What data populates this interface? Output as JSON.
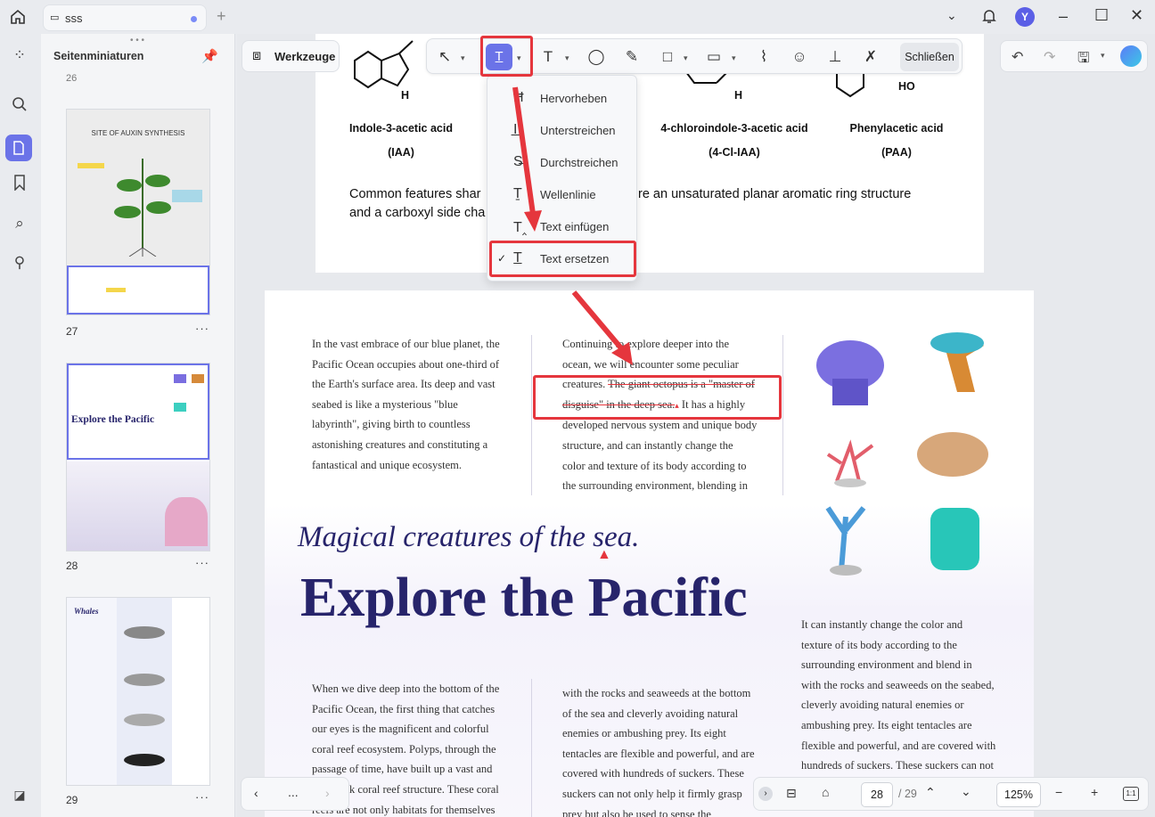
{
  "window": {
    "tab_title": "sss",
    "avatar_letter": "Y"
  },
  "sidebar": {
    "title": "Seitenminiaturen",
    "pages": [
      {
        "number": "27",
        "thumb_title": "SITE OF AUXIN SYNTHESIS"
      },
      {
        "number": "28",
        "thumb_title": "Explore the Pacific"
      },
      {
        "number": "29",
        "thumb_title": "Whales"
      }
    ]
  },
  "toolbar": {
    "tools_label": "Werkzeuge",
    "close_label": "Schließen"
  },
  "dropdown": {
    "items": [
      {
        "label": "Hervorheben",
        "icon": "highlight-icon"
      },
      {
        "label": "Unterstreichen",
        "icon": "underline-icon"
      },
      {
        "label": "Durchstreichen",
        "icon": "strikethrough-icon"
      },
      {
        "label": "Wellenlinie",
        "icon": "squiggly-icon"
      },
      {
        "label": "Text einfügen",
        "icon": "insert-text-icon"
      },
      {
        "label": "Text ersetzen",
        "icon": "replace-text-icon",
        "checked": true
      }
    ]
  },
  "page27": {
    "compounds": [
      {
        "name": "Indole-3-acetic acid",
        "abbr": "(IAA)"
      },
      {
        "name": "4-chloroindole-3-acetic acid",
        "abbr": "(4-Cl-IAA)"
      },
      {
        "name": "Phenylacetic acid",
        "abbr": "(PAA)"
      }
    ],
    "atom_labels": [
      "H",
      "H",
      "HO"
    ],
    "features_line1_left": "Common features shar",
    "features_line1_right": "re an unsaturated planar aromatic ring structure",
    "features_line2": "and a carboxyl side cha"
  },
  "page28": {
    "col1_top": [
      "In the vast embrace of our blue planet, the",
      "Pacific Ocean occupies about one-third of",
      "the Earth's surface area. Its deep and vast",
      "seabed is like a mysterious \"blue",
      "labyrinth\", giving birth to countless",
      "astonishing creatures and constituting a",
      "fantastical and unique ecosystem."
    ],
    "col2_top": [
      "Continuing to explore deeper into the",
      "ocean, we will encounter some peculiar"
    ],
    "col2_line3_plain": "creatures.",
    "col2_line3_struck": "The giant octopus is a \"master of",
    "col2_line4_struck": "disguise\" in the deep sea.",
    "col2_line4_plain": "It has a highly",
    "col2_rest": [
      "developed nervous system and unique body",
      "structure, and can instantly change the",
      "color and texture of its body according to",
      "the surrounding environment, blending in"
    ],
    "subtitle": "Magical creatures of the sea.",
    "headline": "Explore the Pacific",
    "col1_bottom": [
      "When we dive deep into the bottom of the",
      "Pacific Ocean, the first thing that catches",
      "our eyes is the magnificent and colorful",
      "coral reef ecosystem. Polyps, through the",
      "passage of time, have built up a vast and",
      "k coral reef structure. These coral",
      "reefs are not only habitats for themselves"
    ],
    "col2_bottom": [
      "with the rocks and seaweeds at the bottom",
      "of the sea and cleverly avoiding natural",
      "enemies or ambushing prey. Its eight",
      "tentacles are flexible and powerful, and are",
      "covered with hundreds of suckers. These",
      "suckers can not only help it firmly grasp",
      "prey but also be used to sense the"
    ],
    "col3_bottom": [
      "It can instantly change the color and",
      "texture of its body according to the",
      "surrounding environment and blend in",
      "with the rocks and seaweeds on the seabed,",
      "cleverly avoiding natural enemies or",
      "ambushing prey. Its eight tentacles are",
      "flexible and powerful, and are covered with",
      "hundreds of suckers. These suckers can not"
    ]
  },
  "footer": {
    "current_page": "28",
    "total_pages": "/ 29",
    "zoom": "125%",
    "fit_label": "1:1",
    "nav_more": "..."
  },
  "colors": {
    "accent": "#6b73e8",
    "annotation_red": "#e5363d",
    "headline": "#27246b"
  }
}
